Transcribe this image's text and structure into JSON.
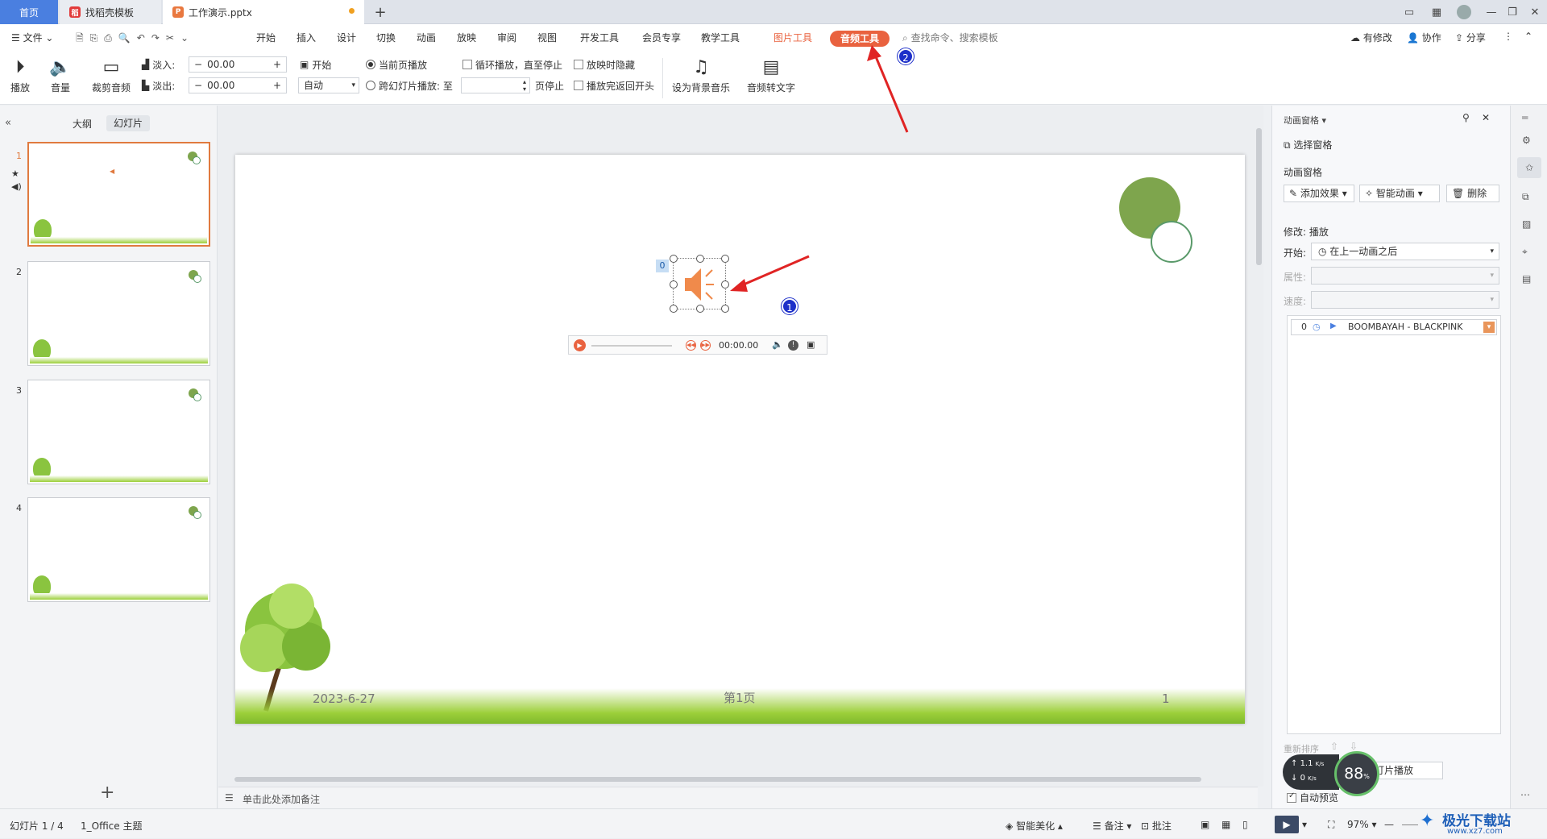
{
  "tabs": {
    "home": "首页",
    "template": "找稻壳模板",
    "doc": "工作演示.pptx",
    "new": "+"
  },
  "menu": {
    "file": "文件",
    "items": [
      "开始",
      "插入",
      "设计",
      "切换",
      "动画",
      "放映",
      "审阅",
      "视图",
      "开发工具",
      "会员专享",
      "教学工具"
    ],
    "picture_tools": "图片工具",
    "audio_tools": "音频工具",
    "search_placeholder": "查找命令、搜索模板",
    "modified": "有修改",
    "collab": "协作",
    "share": "分享"
  },
  "ribbon": {
    "play": "播放",
    "volume": "音量",
    "trim": "裁剪音频",
    "fade_in_label": "淡入:",
    "fade_in_value": "00.00",
    "fade_out_label": "淡出:",
    "fade_out_value": "00.00",
    "start_label": "开始",
    "start_value": "自动",
    "current_page": "当前页播放",
    "cross_slides": "跨幻灯片播放: 至",
    "page_stop": "页停止",
    "loop": "循环播放，直至停止",
    "hide_on_show": "放映时隐藏",
    "rewind": "播放完返回开头",
    "bg_music": "设为背景音乐",
    "to_text": "音频转文字"
  },
  "left": {
    "outline": "大纲",
    "slides": "幻灯片",
    "thumbs": [
      "1",
      "2",
      "3",
      "4"
    ],
    "add": "+"
  },
  "slide": {
    "date": "2023-6-27",
    "page": "第1页",
    "num": "1",
    "anim_index": "0",
    "player_time": "00:00.00"
  },
  "callouts": [
    "1",
    "2"
  ],
  "notes": {
    "placeholder": "单击此处添加备注"
  },
  "right": {
    "title": "动画窗格",
    "select_pane": "选择窗格",
    "section": "动画窗格",
    "add_effect": "添加效果",
    "smart_anim": "智能动画",
    "delete": "删除",
    "modify": "修改: 播放",
    "start_label": "开始:",
    "start_value": "在上一动画之后",
    "prop_label": "属性:",
    "speed_label": "速度:",
    "item_index": "0",
    "item_name": "BOOMBAYAH - BLACKPINK",
    "reorder": "重新排序",
    "play_btn": "灯片播放",
    "autopreview": "自动预览"
  },
  "speedwidget": {
    "up": "1.1",
    "down": "0",
    "unit": "K/s",
    "percent": "88",
    "pct_sign": "%"
  },
  "status": {
    "slide_info": "幻灯片 1 / 4",
    "theme": "1_Office 主题",
    "beautify": "智能美化",
    "notes": "备注",
    "comments": "批注",
    "zoom": "97%"
  },
  "watermark": {
    "text": "极光下载站",
    "url": "www.xz7.com"
  },
  "colors": {
    "accent": "#e9623f",
    "blue": "#4a7fe0",
    "green": "#7ea54d"
  }
}
